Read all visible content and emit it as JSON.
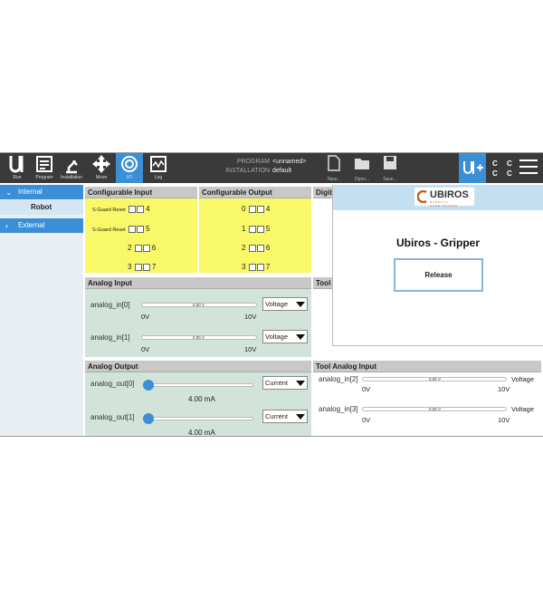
{
  "topbar": {
    "tabs": [
      {
        "label": "Run",
        "icon": "ur-logo-icon"
      },
      {
        "label": "Program",
        "icon": "program-icon"
      },
      {
        "label": "Installation",
        "icon": "robot-arm-icon"
      },
      {
        "label": "Move",
        "icon": "move-arrows-icon"
      },
      {
        "label": "I/O",
        "icon": "io-icon"
      },
      {
        "label": "Log",
        "icon": "log-icon"
      }
    ],
    "program_label": "PROGRAM",
    "program_value": "<unnamed>",
    "installation_label": "INSTALLATION",
    "installation_value": "default",
    "new_label": "New...",
    "open_label": "Open...",
    "save_label": "Save...",
    "cc_text": [
      "C C",
      "C C"
    ]
  },
  "sidenav": {
    "internal": "Internal",
    "robot": "Robot",
    "external": "External"
  },
  "panels": {
    "config_input": {
      "title": "Configurable Input",
      "rows": [
        {
          "left_label": "S-Guard Reset",
          "right_num": "4"
        },
        {
          "left_label": "S-Guard Reset",
          "right_num": "5"
        },
        {
          "left_label": "2",
          "right_num": "6"
        },
        {
          "left_label": "3",
          "right_num": "7"
        }
      ]
    },
    "config_output": {
      "title": "Configurable Output",
      "rows": [
        {
          "left": "0",
          "right": "4"
        },
        {
          "left": "1",
          "right": "5"
        },
        {
          "left": "2",
          "right": "6"
        },
        {
          "left": "3",
          "right": "7"
        }
      ]
    },
    "digital_title": "Digit",
    "tool_title": "Tool",
    "analog_input": {
      "title": "Analog Input",
      "inputs": [
        {
          "name": "analog_in[0]",
          "value": "0.00 V",
          "min": "0V",
          "max": "10V",
          "mode": "Voltage"
        },
        {
          "name": "analog_in[1]",
          "value": "0.00 V",
          "min": "0V",
          "max": "10V",
          "mode": "Voltage"
        }
      ]
    },
    "analog_output": {
      "title": "Analog Output",
      "outputs": [
        {
          "name": "analog_out[0]",
          "value": "4.00 mA",
          "mode": "Current",
          "level": 0
        },
        {
          "name": "analog_out[1]",
          "value": "4.00 mA",
          "mode": "Current",
          "level": 0
        }
      ]
    },
    "tool_analog_input": {
      "title": "Tool Analog Input",
      "inputs": [
        {
          "name": "analog_in[2]",
          "value": "0.00 V",
          "min": "0V",
          "max": "10V",
          "mode": "Voltage"
        },
        {
          "name": "analog_in[3]",
          "value": "0.00 V",
          "min": "0V",
          "max": "10V",
          "mode": "Voltage"
        }
      ]
    }
  },
  "popup": {
    "logo_text": "UBIROS",
    "logo_sub": "ROBOTIC EVERYWHERE",
    "title": "Ubiros - Gripper",
    "release_label": "Release"
  },
  "colors": {
    "accent": "#3a8fd6",
    "topbar": "#3a3a3a",
    "yellow_panel": "#f8f868",
    "green_panel": "#d2e3da",
    "popup_header": "#c5dff2",
    "logo_orange": "#c4601c"
  }
}
